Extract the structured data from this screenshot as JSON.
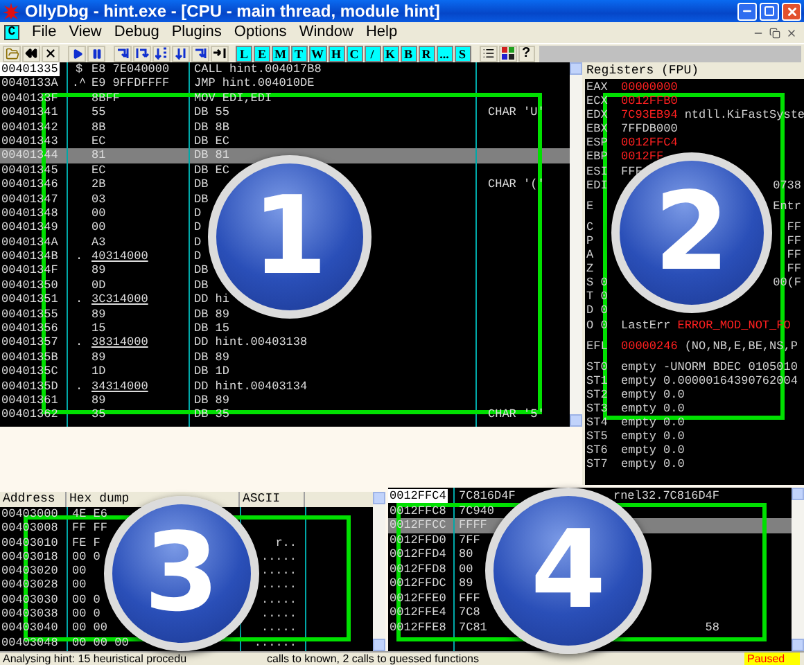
{
  "window": {
    "title": "OllyDbg - hint.exe - [CPU - main thread, module hint]"
  },
  "menu": {
    "icon_letter": "C",
    "items": [
      "File",
      "View",
      "Debug",
      "Plugins",
      "Options",
      "Window",
      "Help"
    ]
  },
  "toolbar": {
    "letter_buttons": [
      "L",
      "E",
      "M",
      "T",
      "W",
      "H",
      "C",
      "/",
      "K",
      "B",
      "R",
      "...",
      "S"
    ],
    "help_label": "?"
  },
  "disassembly": {
    "rows": [
      {
        "address": "00401335",
        "mark": "$",
        "hex": "E8 7E040000",
        "underline": false,
        "command": "CALL hint.004017B8",
        "current": true,
        "highlighted": false
      },
      {
        "address": "0040133A",
        "mark": ".^",
        "hex": "E9 9FFDFFFF",
        "underline": false,
        "command": "JMP hint.004010DE",
        "current": false,
        "highlighted": false
      },
      {
        "address": "0040133F",
        "hex": "8BFF",
        "underline": false,
        "command": "MOV EDI,EDI",
        "current": false,
        "highlighted": false
      },
      {
        "address": "00401341",
        "hex": "55",
        "underline": false,
        "command": "DB 55",
        "comment": "CHAR 'U'",
        "current": false,
        "highlighted": false
      },
      {
        "address": "00401342",
        "hex": "8B",
        "underline": false,
        "command": "DB 8B",
        "current": false,
        "highlighted": false
      },
      {
        "address": "00401343",
        "hex": "EC",
        "underline": false,
        "command": "DB EC",
        "current": false,
        "highlighted": false
      },
      {
        "address": "00401344",
        "hex": "81",
        "underline": false,
        "command": "DB 81",
        "current": false,
        "highlighted": true
      },
      {
        "address": "00401345",
        "hex": "EC",
        "underline": false,
        "command": "DB EC",
        "current": false,
        "highlighted": false
      },
      {
        "address": "00401346",
        "hex": "2B",
        "underline": false,
        "command": "DB",
        "comment": "CHAR '('",
        "current": false,
        "highlighted": false
      },
      {
        "address": "00401347",
        "hex": "03",
        "underline": false,
        "command": "DB",
        "current": false,
        "highlighted": false
      },
      {
        "address": "00401348",
        "hex": "00",
        "underline": false,
        "command": "D",
        "current": false,
        "highlighted": false
      },
      {
        "address": "00401349",
        "hex": "00",
        "underline": false,
        "command": "D",
        "current": false,
        "highlighted": false
      },
      {
        "address": "0040134A",
        "hex": "A3",
        "underline": false,
        "command": "D",
        "current": false,
        "highlighted": false
      },
      {
        "address": "0040134B",
        "mark": ".",
        "hex": "40314000",
        "underline": true,
        "command": "D",
        "current": false,
        "highlighted": false
      },
      {
        "address": "0040134F",
        "hex": "89",
        "underline": false,
        "command": "DB",
        "current": false,
        "highlighted": false
      },
      {
        "address": "00401350",
        "hex": "0D",
        "underline": false,
        "command": "DB",
        "current": false,
        "highlighted": false
      },
      {
        "address": "00401351",
        "mark": ".",
        "hex": "3C314000",
        "underline": true,
        "command": "DD hi",
        "current": false,
        "highlighted": false
      },
      {
        "address": "00401355",
        "hex": "89",
        "underline": false,
        "command": "DB 89",
        "current": false,
        "highlighted": false
      },
      {
        "address": "00401356",
        "hex": "15",
        "underline": false,
        "command": "DB 15",
        "current": false,
        "highlighted": false
      },
      {
        "address": "00401357",
        "mark": ".",
        "hex": "38314000",
        "underline": true,
        "command": "DD hint.00403138",
        "current": false,
        "highlighted": false
      },
      {
        "address": "0040135B",
        "hex": "89",
        "underline": false,
        "command": "DB 89",
        "current": false,
        "highlighted": false
      },
      {
        "address": "0040135C",
        "hex": "1D",
        "underline": false,
        "command": "DB 1D",
        "current": false,
        "highlighted": false
      },
      {
        "address": "0040135D",
        "mark": ".",
        "hex": "34314000",
        "underline": true,
        "command": "DD hint.00403134",
        "current": false,
        "highlighted": false
      },
      {
        "address": "00401361",
        "hex": "89",
        "underline": false,
        "command": "DB 89",
        "current": false,
        "highlighted": false
      },
      {
        "address": "00401362",
        "hex": "35",
        "underline": false,
        "command": "DB 35",
        "comment": "CHAR '5'",
        "current": false,
        "highlighted": false
      }
    ]
  },
  "registers": {
    "title": "Registers (FPU)",
    "lines": [
      {
        "kind": "reg",
        "name": "EAX",
        "value": "00000000",
        "red": true
      },
      {
        "kind": "reg",
        "name": "ECX",
        "value": "0012FFB0",
        "red": true
      },
      {
        "kind": "reg",
        "name": "EDX",
        "value": "7C93EB94",
        "red": true,
        "note": "ntdll.KiFastSyste"
      },
      {
        "kind": "reg",
        "name": "EBX",
        "value": "7FFDB000",
        "red": false
      },
      {
        "kind": "reg",
        "name": "ESP",
        "value": "0012FFC4",
        "red": true
      },
      {
        "kind": "reg",
        "name": "EBP",
        "value": "0012FF",
        "red": true
      },
      {
        "kind": "reg",
        "name": "ESI",
        "value": "FFF",
        "red": false
      },
      {
        "kind": "reg",
        "name": "EDI",
        "tail": "0738"
      },
      {
        "kind": "gap"
      },
      {
        "kind": "reg",
        "name": "E",
        "tail": "Entr"
      },
      {
        "kind": "gap"
      },
      {
        "kind": "reg",
        "name": "C",
        "tail": "FF"
      },
      {
        "kind": "reg",
        "name": "P",
        "tail": "FF"
      },
      {
        "kind": "reg",
        "name": "A",
        "tail": "FF"
      },
      {
        "kind": "reg",
        "name": "Z",
        "tail": "FF"
      },
      {
        "kind": "reg",
        "name": "S 0",
        "tail": "00(F"
      },
      {
        "kind": "reg",
        "name": "T 0"
      },
      {
        "kind": "reg",
        "name": "D 0"
      },
      {
        "kind": "reg",
        "name": "O 0",
        "value": "LastErr",
        "red": false,
        "note": "ERROR_MOD_NOT_FO",
        "note_red": true
      },
      {
        "kind": "gap"
      },
      {
        "kind": "reg",
        "name": "EFL",
        "value": "00000246",
        "red": true,
        "note": "(NO,NB,E,BE,NS,P"
      },
      {
        "kind": "gap"
      },
      {
        "kind": "reg",
        "name": "ST0",
        "value": "empty",
        "red": false,
        "note": "-UNORM BDEC 0105010"
      },
      {
        "kind": "reg",
        "name": "ST1",
        "value": "empty",
        "red": false,
        "note": "0.00000164390762004"
      },
      {
        "kind": "reg",
        "name": "ST2",
        "value": "empty",
        "red": false,
        "note": "0.0"
      },
      {
        "kind": "reg",
        "name": "ST3",
        "value": "empty",
        "red": false,
        "note": "0.0"
      },
      {
        "kind": "reg",
        "name": "ST4",
        "value": "empty",
        "red": false,
        "note": "0.0"
      },
      {
        "kind": "reg",
        "name": "ST5",
        "value": "empty",
        "red": false,
        "note": "0.0"
      },
      {
        "kind": "reg",
        "name": "ST6",
        "value": "empty",
        "red": false,
        "note": "0.0"
      },
      {
        "kind": "reg",
        "name": "ST7",
        "value": "empty",
        "red": false,
        "note": "0.0"
      }
    ]
  },
  "dump": {
    "columns": [
      "Address",
      "Hex dump",
      "ASCII"
    ],
    "rows": [
      {
        "address": "00403000",
        "hex": "4E E6"
      },
      {
        "address": "00403008",
        "hex": "FF FF"
      },
      {
        "address": "00403010",
        "hex": "FE F",
        "ascii": "r.."
      },
      {
        "address": "00403018",
        "hex": "00 0",
        "ascii": "....."
      },
      {
        "address": "00403020",
        "hex": "00",
        "ascii": "....."
      },
      {
        "address": "00403028",
        "hex": "00",
        "ascii": "....."
      },
      {
        "address": "00403030",
        "hex": "00 0",
        "ascii": "....."
      },
      {
        "address": "00403038",
        "hex": "00 0",
        "ascii": "....."
      },
      {
        "address": "00403040",
        "hex": "00 00",
        "ascii": "....."
      },
      {
        "address": "00403048",
        "hex": "00 00 00",
        "ascii": "......"
      }
    ]
  },
  "stack": {
    "rows": [
      {
        "address": "0012FFC4",
        "value": "7C816D4F",
        "comment": "rnel32.7C816D4F",
        "current": true,
        "highlighted": false
      },
      {
        "address": "0012FFC8",
        "value": "7C940",
        "current": false,
        "highlighted": false
      },
      {
        "address": "0012FFCC",
        "value": "FFFF",
        "current": false,
        "highlighted": true
      },
      {
        "address": "0012FFD0",
        "value": "7FF",
        "current": false,
        "highlighted": false
      },
      {
        "address": "0012FFD4",
        "value": "80",
        "current": false,
        "highlighted": false
      },
      {
        "address": "0012FFD8",
        "value": "00",
        "current": false,
        "highlighted": false
      },
      {
        "address": "0012FFDC",
        "value": "89",
        "current": false,
        "highlighted": false
      },
      {
        "address": "0012FFE0",
        "value": "FFF",
        "current": false,
        "highlighted": false
      },
      {
        "address": "0012FFE4",
        "value": "7C8",
        "current": false,
        "highlighted": false
      },
      {
        "address": "0012FFE8",
        "value": "7C81",
        "comment": "58",
        "current": false,
        "highlighted": false
      }
    ]
  },
  "status_bar": {
    "message_start": "Analysing hint: 15 heuristical procedu",
    "message_end": "calls to known, 2 calls to guessed functions",
    "state": "Paused"
  },
  "callouts": [
    {
      "number": "1"
    },
    {
      "number": "2"
    },
    {
      "number": "3"
    },
    {
      "number": "4"
    }
  ]
}
